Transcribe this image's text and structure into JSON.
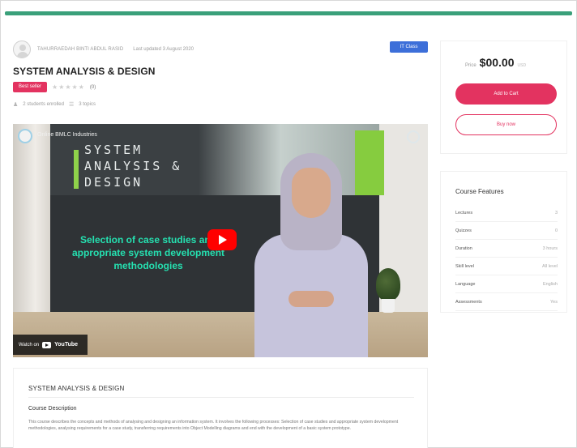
{
  "header": {
    "author": "TAHURRAEDAH BINTI ABDUL RASID",
    "updated": "Last updated 3 August 2020",
    "category": "IT Class"
  },
  "course": {
    "title": "SYSTEM ANALYSIS & DESIGN",
    "badge": "Best seller",
    "stars": "★★★★★",
    "rating_count": "(0)",
    "students": "2 students enrolled",
    "lessons": "3 topics"
  },
  "video": {
    "channel": "Online BMLC Industries",
    "slide_title_lines": [
      "SYSTEM",
      "ANALYSIS &",
      "DESIGN"
    ],
    "slide_subtitle": "Selection of case studies and appropriate system development methodologies",
    "watch_on": "Watch on",
    "youtube": "YouTube"
  },
  "description": {
    "title": "SYSTEM ANALYSIS & DESIGN",
    "heading": "Course Description",
    "body": "This course describes the concepts and methods of analysing and designing an information system. It involves the following processes: Selection of case studies and appropriate system development methodologies, analysing requirements for a case study, transferring requirements into Object Modelling diagrams and end with the development of a basic system prototype."
  },
  "sidebar": {
    "price_label": "Price",
    "price": "$00.00",
    "price_suffix": "USD",
    "add_to_cart": "Add to Cart",
    "buy_now": "Buy now",
    "features_title": "Course Features",
    "features": [
      {
        "label": "Lectures",
        "value": "3"
      },
      {
        "label": "Quizzes",
        "value": "0"
      },
      {
        "label": "Duration",
        "value": "3 hours"
      },
      {
        "label": "Skill level",
        "value": "All level"
      },
      {
        "label": "Language",
        "value": "English"
      },
      {
        "label": "Assessments",
        "value": "Yes"
      }
    ]
  },
  "colors": {
    "accent": "#e33360",
    "category": "#3d6fd9",
    "topbar": "#3aa07a",
    "slide_text": "#25e0b0"
  }
}
